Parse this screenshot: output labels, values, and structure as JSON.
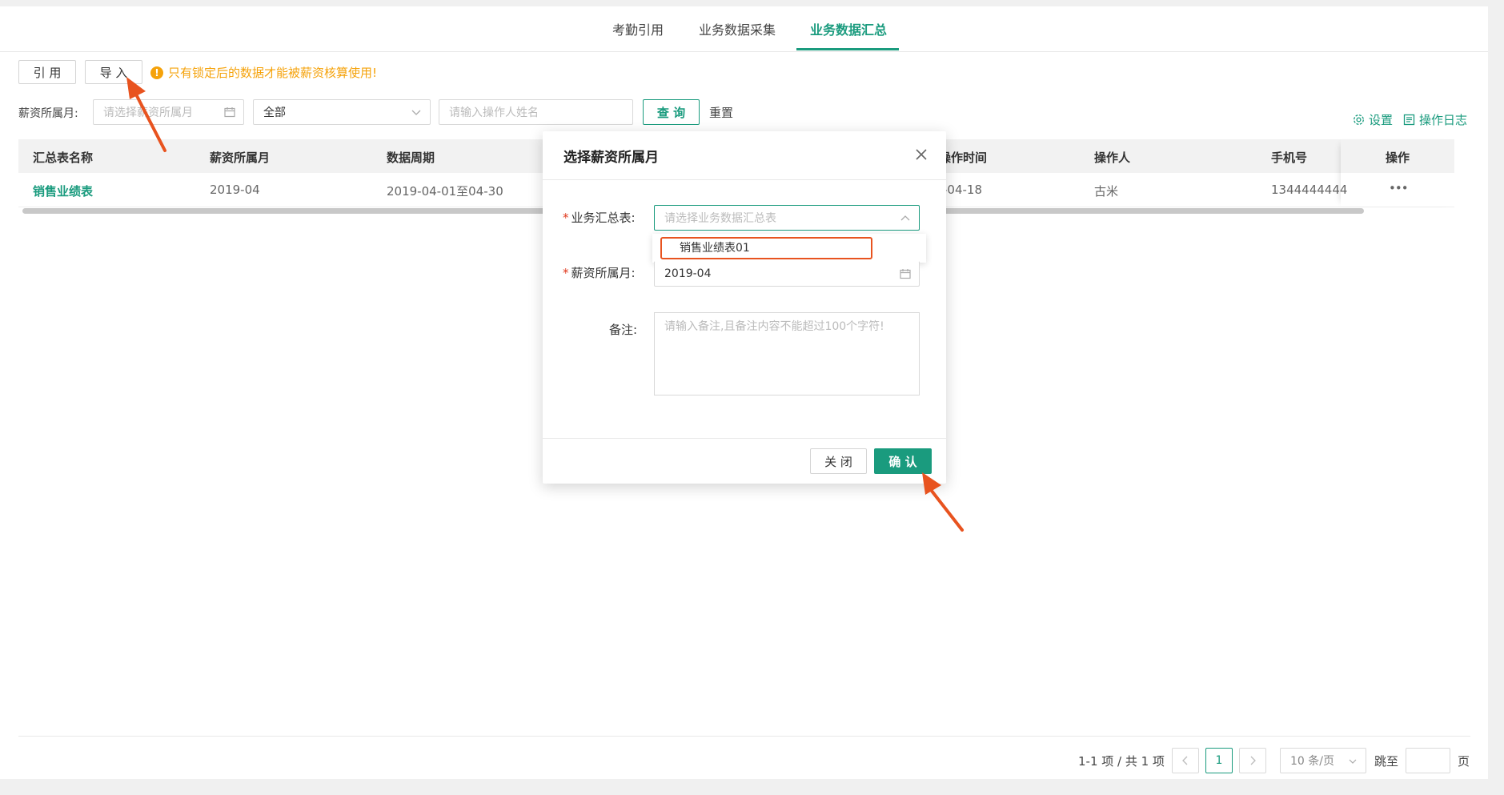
{
  "tabs": [
    {
      "label": "考勤引用"
    },
    {
      "label": "业务数据采集"
    },
    {
      "label": "业务数据汇总"
    }
  ],
  "toolbar": {
    "cite_label": "引 用",
    "import_label": "导 入",
    "warning": "只有锁定后的数据才能被薪资核算使用!"
  },
  "filters": {
    "month_label": "薪资所属月:",
    "month_placeholder": "请选择薪资所属月",
    "status_value": "全部",
    "operator_placeholder": "请输入操作人姓名",
    "query_label": "查 询",
    "reset_label": "重置",
    "settings_label": "设置",
    "log_label": "操作日志"
  },
  "table": {
    "columns": [
      "汇总表名称",
      "薪资所属月",
      "数据周期",
      "操作时间",
      "操作人",
      "手机号",
      "操作"
    ],
    "rows": [
      {
        "name": "销售业绩表",
        "month": "2019-04",
        "period": "2019-04-01至04-30",
        "op_time": "-04-18",
        "operator": "古米",
        "phone": "1344444444",
        "actions": "•••"
      }
    ]
  },
  "modal": {
    "title": "选择薪资所属月",
    "summary_label": "业务汇总表:",
    "summary_placeholder": "请选择业务数据汇总表",
    "dropdown_option": "销售业绩表01",
    "month_label": "薪资所属月:",
    "month_value": "2019-04",
    "note_label": "备注:",
    "note_placeholder": "请输入备注,且备注内容不能超过100个字符!",
    "close_label": "关 闭",
    "confirm_label": "确 认"
  },
  "pagination": {
    "summary": "1-1 项 / 共 1 项",
    "current_page": "1",
    "page_size": "10 条/页",
    "jump_label": "跳至",
    "page_unit": "页"
  },
  "colors": {
    "primary": "#1a9b7e",
    "warning": "#f5a20a",
    "annotation": "#e8531f"
  }
}
